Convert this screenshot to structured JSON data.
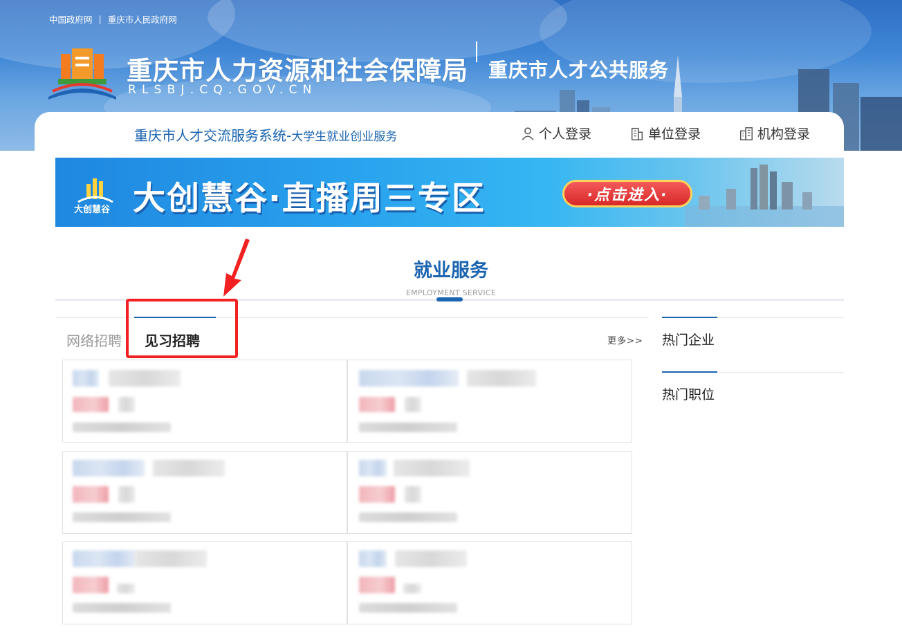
{
  "header": {
    "top_links": [
      "中国政府网",
      "重庆市人民政府网"
    ],
    "top_separator": "|",
    "site_title": "重庆市人力资源和社会保障局",
    "site_domain": "RLSBJ.CQ.GOV.CN",
    "subsite_title": "重庆市人才公共服务",
    "system_title": "重庆市人才交流服务系统-",
    "system_subtitle": "大学生就业创业服务",
    "logins": {
      "personal": "个人登录",
      "company": "单位登录",
      "institution": "机构登录"
    }
  },
  "banner": {
    "logo_text": "大创慧谷",
    "title": "大创慧谷·直播周三专区",
    "button": "·点击进入·"
  },
  "section": {
    "title": "就业服务",
    "subtitle": "EMPLOYMENT SERVICE"
  },
  "tabs": {
    "items": [
      {
        "label": "网络招聘",
        "active": false
      },
      {
        "label": "见习招聘",
        "active": true
      }
    ],
    "more": "更多>>"
  },
  "sidebar": {
    "sections": [
      "热门企业",
      "热门职位"
    ]
  },
  "colors": {
    "brand_blue": "#1a64b0",
    "annotation_red": "#f22020"
  },
  "icons": [
    "user-icon",
    "building-icon",
    "institution-icon",
    "logo-emblem-icon"
  ]
}
